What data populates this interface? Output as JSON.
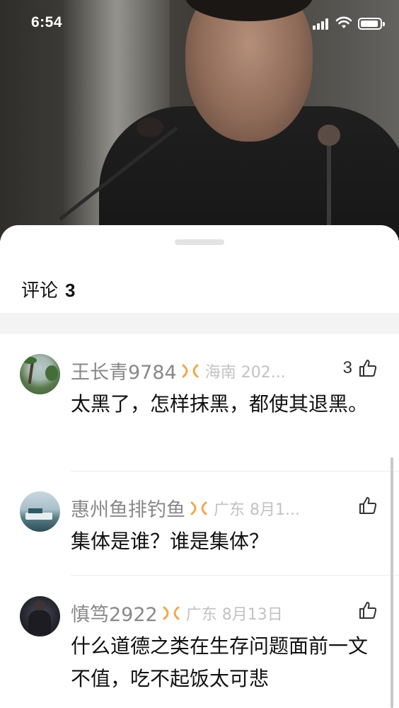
{
  "status_bar": {
    "time": "6:54"
  },
  "panel": {
    "title": "评论",
    "count": "3"
  },
  "comments": [
    {
      "username": "王长青9784",
      "location": "海南 202...",
      "likes": "3",
      "text": "太黑了，怎样抹黑，都使其退黑。"
    },
    {
      "username": "惠州鱼排钓鱼",
      "location": "广东 8月1...",
      "likes": "",
      "text": "集体是谁？谁是集体？"
    },
    {
      "username": "慎笃2922",
      "location": "广东 8月13日",
      "likes": "",
      "text": "什么道德之类在生存问题面前一文不值，吃不起饭太可悲"
    }
  ],
  "icons": {
    "badge": "vip-badge-icon",
    "like": "thumbs-up-icon",
    "signal": "cellular-signal-icon",
    "wifi": "wifi-icon",
    "battery": "battery-icon"
  },
  "colors": {
    "badge": "#f2a64a",
    "username": "#888888",
    "location": "#c2c2c2"
  }
}
